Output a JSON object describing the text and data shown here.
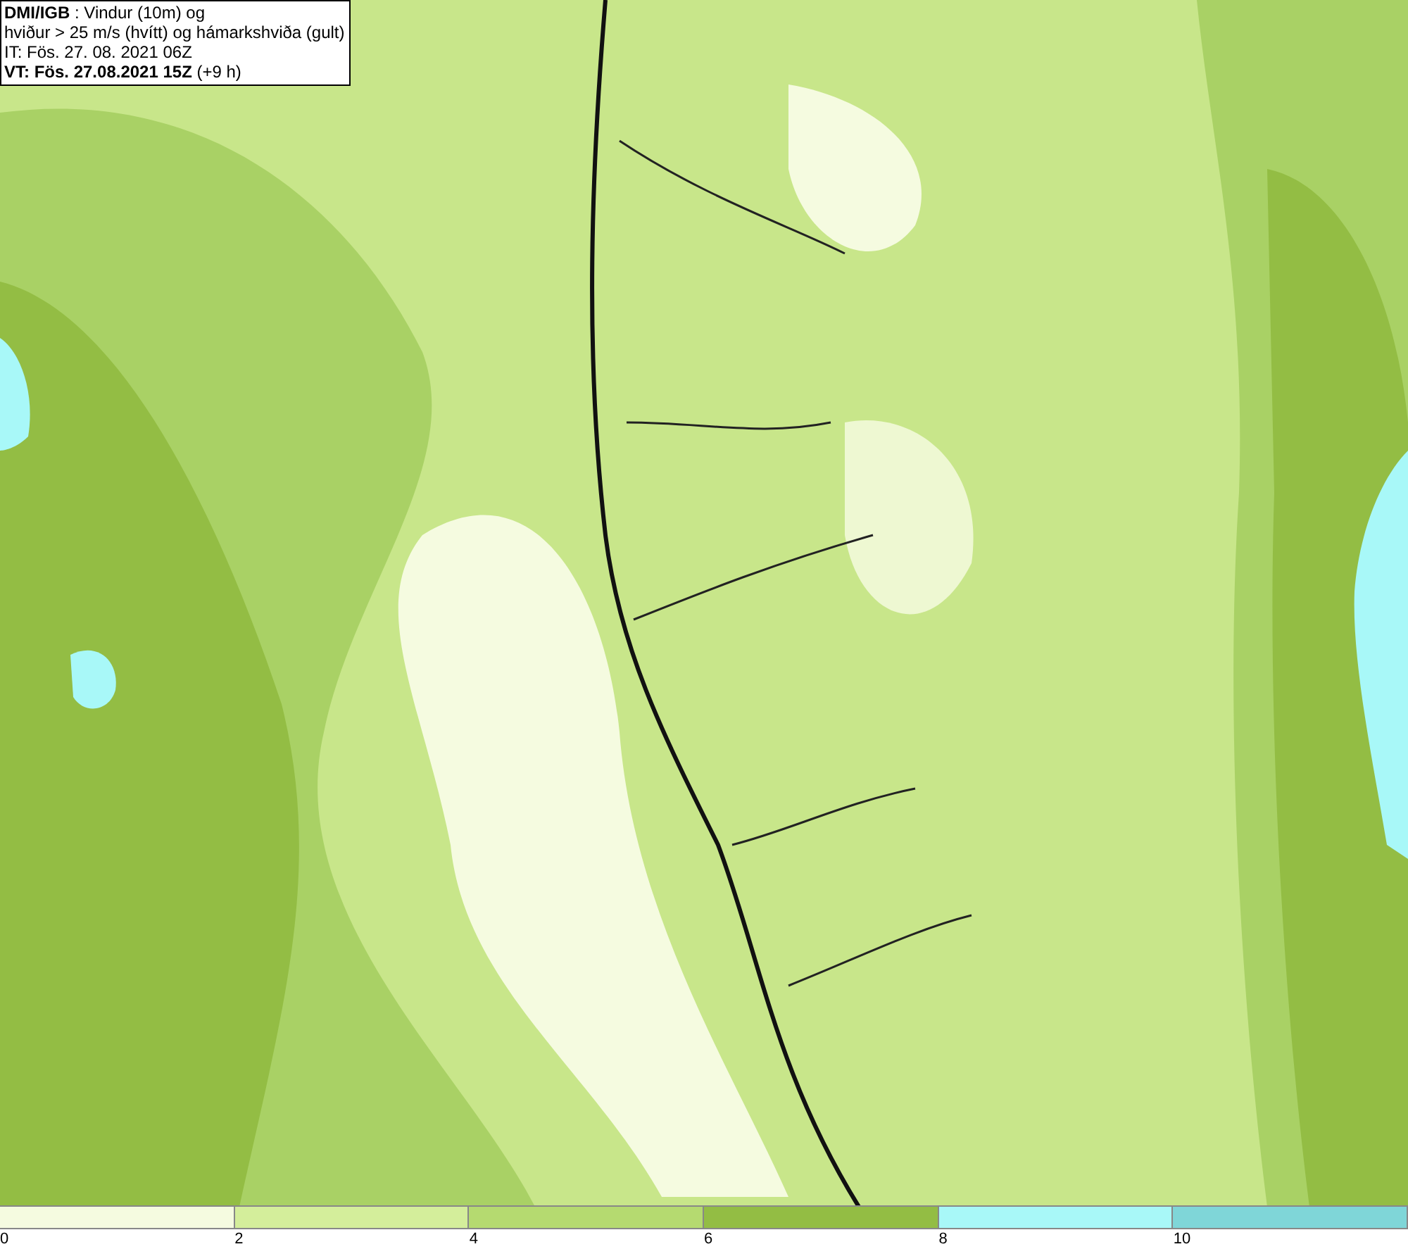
{
  "title_box": {
    "lines": [
      "**DMI/IGB** : Vindur (10m) og",
      "hviður > 25 m/s (hvítt) og hámarkshviða (gult)",
      "IT: Fös. 27. 08. 2021 06Z",
      "**VT: Fös. 27.08.2021 15Z** (+9 h)"
    ]
  },
  "legend": {
    "bins": [
      {
        "color": "#f5fbe0"
      },
      {
        "color": "#d4ee9b"
      },
      {
        "color": "#b5da70"
      },
      {
        "color": "#93bd44"
      },
      {
        "color": "#a8f8f8"
      },
      {
        "color": "#7fd6d8"
      }
    ],
    "ticks": [
      "0",
      "2",
      "4",
      "6",
      "8",
      "10"
    ]
  }
}
